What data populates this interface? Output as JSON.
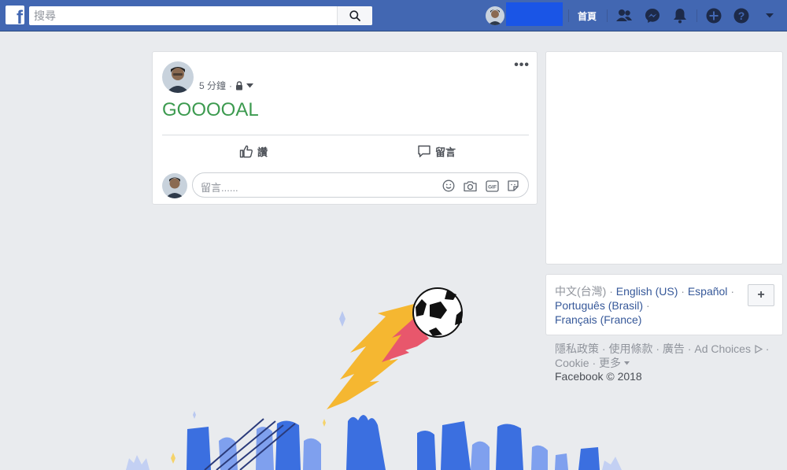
{
  "topbar": {
    "logo": "f",
    "search_placeholder": "搜尋",
    "home_label": "首頁",
    "icons": [
      "search-icon",
      "friends-icon",
      "messenger-icon",
      "notifications-icon",
      "create-icon",
      "help-icon",
      "dropdown-icon"
    ],
    "colors": {
      "bar": "#4267b2",
      "name_block": "#1a55e6"
    }
  },
  "post": {
    "time": "5 分鐘",
    "dot": "·",
    "privacy_icon": "lock-icon",
    "options": "•••",
    "text": "GOOOOAL",
    "text_color": "#3c9a4f",
    "like_label": "讚",
    "comment_label": "留言",
    "comment_placeholder": "留言......",
    "comment_icons": [
      "emoji-icon",
      "camera-icon",
      "gif-icon",
      "sticker-icon"
    ]
  },
  "languages": {
    "current": "中文(台灣)",
    "others": [
      "English (US)",
      "Español",
      "Português (Brasil)",
      "Français (France)"
    ],
    "separator": "·",
    "add_label": "+"
  },
  "footer": {
    "links": [
      "隱私政策",
      "使用條款",
      "廣告",
      "Ad Choices",
      "Cookie",
      "更多"
    ],
    "copyright": "Facebook © 2018"
  }
}
